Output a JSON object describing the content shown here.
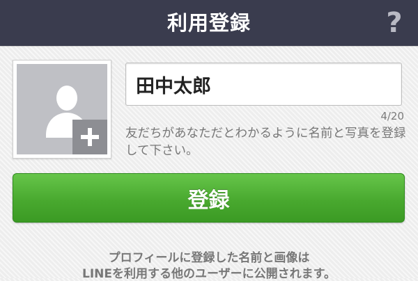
{
  "header": {
    "title": "利用登録",
    "help_icon": "question-mark-icon",
    "background": "#3a3c4e"
  },
  "avatar": {
    "person_icon": "person-silhouette-icon",
    "add_icon": "plus-icon"
  },
  "name_field": {
    "value": "田中太郎",
    "char_count": "4/20"
  },
  "instructions": "友だちがあなただとわかるように名前と写真を登録して下さい。",
  "register_button": {
    "label": "登録",
    "color": "#4caf35"
  },
  "notice": {
    "line1": "プロフィールに登録した名前と画像は",
    "line2": "LINEを利用する他のユーザーに公開されます。"
  }
}
